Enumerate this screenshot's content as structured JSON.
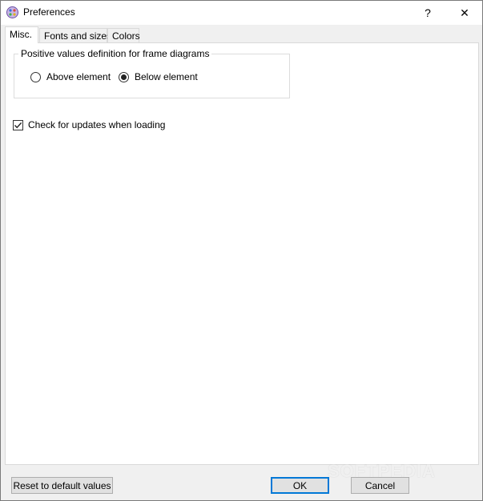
{
  "window": {
    "title": "Preferences",
    "help_glyph": "?",
    "close_glyph": "✕"
  },
  "tabs": [
    {
      "label": "Misc.",
      "active": true
    },
    {
      "label": "Fonts and sizes",
      "active": false
    },
    {
      "label": "Colors",
      "active": false
    }
  ],
  "misc": {
    "group_label": "Positive values definition for frame diagrams",
    "radio_options": [
      {
        "label": "Above element",
        "selected": false
      },
      {
        "label": "Below element",
        "selected": true
      }
    ],
    "check_updates": {
      "label": "Check for updates when loading",
      "checked": true
    }
  },
  "buttons": {
    "reset_label": "Reset to default values",
    "ok_label": "OK",
    "cancel_label": "Cancel"
  },
  "watermark": "SOFTPEDIA",
  "icons": {
    "app": "app-icon",
    "help": "help-icon",
    "close": "close-icon",
    "check": "checkmark-icon"
  },
  "colors": {
    "accent": "#0078d7",
    "panel_bg": "#ffffff",
    "window_bg": "#f0f0f0"
  }
}
